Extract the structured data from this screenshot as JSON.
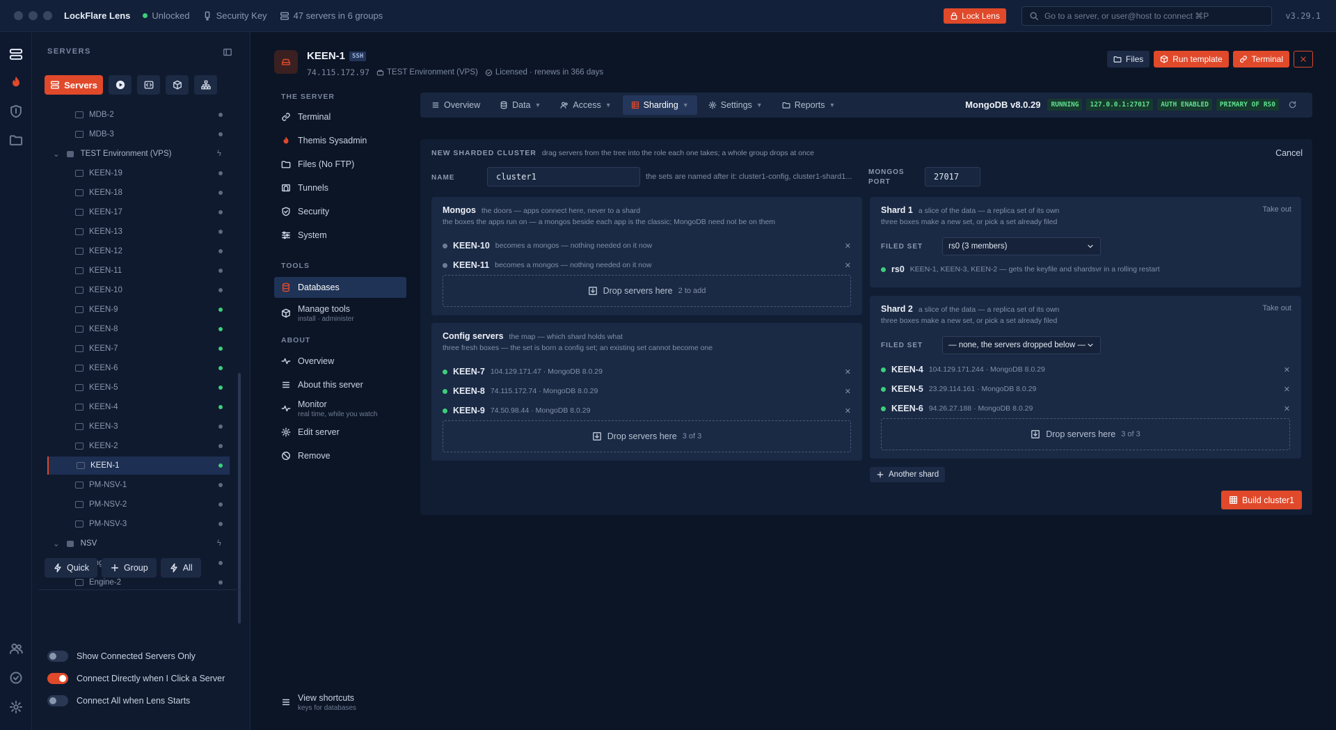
{
  "app": {
    "title": "LockFlare Lens",
    "status": "Unlocked",
    "security_key": "Security Key",
    "servers_summary": "47 servers in 6 groups",
    "lock_label": "Lock Lens",
    "search_placeholder": "Go to a server, or user@host to connect  ⌘P",
    "version": "v3.29.1",
    "accent": "#e0492a"
  },
  "sidebar": {
    "heading": "SERVERS",
    "primary_button": "Servers",
    "tree": [
      {
        "label": "MDB-2",
        "type": "server",
        "status": "grey"
      },
      {
        "label": "MDB-3",
        "type": "server",
        "status": "grey"
      },
      {
        "label": "TEST Environment (VPS)",
        "type": "group"
      },
      {
        "label": "KEEN-19",
        "type": "server",
        "status": "grey"
      },
      {
        "label": "KEEN-18",
        "type": "server",
        "status": "grey"
      },
      {
        "label": "KEEN-17",
        "type": "server",
        "status": "grey"
      },
      {
        "label": "KEEN-13",
        "type": "server",
        "status": "grey"
      },
      {
        "label": "KEEN-12",
        "type": "server",
        "status": "grey"
      },
      {
        "label": "KEEN-11",
        "type": "server",
        "status": "grey"
      },
      {
        "label": "KEEN-10",
        "type": "server",
        "status": "grey"
      },
      {
        "label": "KEEN-9",
        "type": "server",
        "status": "green"
      },
      {
        "label": "KEEN-8",
        "type": "server",
        "status": "green"
      },
      {
        "label": "KEEN-7",
        "type": "server",
        "status": "green"
      },
      {
        "label": "KEEN-6",
        "type": "server",
        "status": "green"
      },
      {
        "label": "KEEN-5",
        "type": "server",
        "status": "green"
      },
      {
        "label": "KEEN-4",
        "type": "server",
        "status": "green"
      },
      {
        "label": "KEEN-3",
        "type": "server",
        "status": "grey"
      },
      {
        "label": "KEEN-2",
        "type": "server",
        "status": "grey"
      },
      {
        "label": "KEEN-1",
        "type": "server",
        "status": "green",
        "selected": true
      },
      {
        "label": "PM-NSV-1",
        "type": "server",
        "status": "grey"
      },
      {
        "label": "PM-NSV-2",
        "type": "server",
        "status": "grey"
      },
      {
        "label": "PM-NSV-3",
        "type": "server",
        "status": "grey"
      },
      {
        "label": "NSV",
        "type": "group"
      },
      {
        "label": "Engine-1",
        "type": "server",
        "status": "grey"
      },
      {
        "label": "Engine-2",
        "type": "server",
        "status": "grey"
      }
    ],
    "actions": {
      "quick": "Quick",
      "group": "Group",
      "all": "All"
    },
    "toggles": [
      {
        "label": "Show Connected Servers Only",
        "on": false
      },
      {
        "label": "Connect Directly when I Click a Server",
        "on": true
      },
      {
        "label": "Connect All when Lens Starts",
        "on": false
      }
    ]
  },
  "server": {
    "name": "KEEN-1",
    "protocol": "SSH",
    "ip": "74.115.172.97",
    "group": "TEST Environment (VPS)",
    "license": "Licensed · renews in 366 days",
    "buttons": {
      "files": "Files",
      "run_template": "Run template",
      "terminal": "Terminal"
    }
  },
  "nav": {
    "the_server_heading": "THE SERVER",
    "the_server": [
      "Terminal",
      "Themis Sysadmin",
      "Files (No FTP)",
      "Tunnels",
      "Security",
      "System"
    ],
    "tools_heading": "TOOLS",
    "databases": "Databases",
    "manage_tools": "Manage tools",
    "manage_tools_sub": "install · administer",
    "about_heading": "ABOUT",
    "overview": "Overview",
    "about_server": "About this server",
    "monitor": "Monitor",
    "monitor_sub": "real time, while you watch",
    "edit": "Edit server",
    "remove": "Remove",
    "shortcuts": "View shortcuts",
    "shortcuts_sub": "keys for databases"
  },
  "tabs": [
    "Overview",
    "Data",
    "Access",
    "Sharding",
    "Settings",
    "Reports"
  ],
  "mongodb": {
    "version": "MongoDB v8.0.29",
    "badges": [
      "RUNNING",
      "127.0.0.1:27017",
      "AUTH ENABLED",
      "PRIMARY OF RS0"
    ]
  },
  "cluster": {
    "heading": "NEW SHARDED CLUSTER",
    "heading_hint": "drag servers from the tree into the role each one takes; a whole group drops at once",
    "cancel": "Cancel",
    "name_label": "NAME",
    "name_value": "cluster1",
    "name_hint": "the sets are named after it: cluster1-config, cluster1-shard1...",
    "port_label_1": "MONGOS",
    "port_label_2": "PORT",
    "port_value": "27017",
    "drop_label": "Drop servers here",
    "mongos": {
      "title": "Mongos",
      "tagline": "the doors — apps connect here, never to a shard",
      "sub": "the boxes the apps run on — a mongos beside each app is the classic; MongoDB need not be on them",
      "members": [
        {
          "name": "KEEN-10",
          "info": "becomes a mongos — nothing needed on it now"
        },
        {
          "name": "KEEN-11",
          "info": "becomes a mongos — nothing needed on it now"
        }
      ],
      "count": "2 to add"
    },
    "config": {
      "title": "Config servers",
      "tagline": "the map — which shard holds what",
      "sub": "three fresh boxes — the set is born a config set; an existing set cannot become one",
      "members": [
        {
          "name": "KEEN-7",
          "info": "104.129.171.47 · MongoDB 8.0.29"
        },
        {
          "name": "KEEN-8",
          "info": "74.115.172.74 · MongoDB 8.0.29"
        },
        {
          "name": "KEEN-9",
          "info": "74.50.98.44 · MongoDB 8.0.29"
        }
      ],
      "count": "3 of 3"
    },
    "shard1": {
      "title": "Shard 1",
      "tagline": "a slice of the data — a replica set of its own",
      "sub": "three boxes make a new set, or pick a set already filed",
      "take_out": "Take out",
      "filed_label": "FILED SET",
      "filed_value": "rs0 (3 members)",
      "rs_name": "rs0",
      "rs_info": "KEEN-1, KEEN-3, KEEN-2 — gets the keyfile and shardsvr in a rolling restart"
    },
    "shard2": {
      "title": "Shard 2",
      "tagline": "a slice of the data — a replica set of its own",
      "sub": "three boxes make a new set, or pick a set already filed",
      "take_out": "Take out",
      "filed_label": "FILED SET",
      "filed_value": "— none, the servers dropped below —",
      "members": [
        {
          "name": "KEEN-4",
          "info": "104.129.171.244 · MongoDB 8.0.29"
        },
        {
          "name": "KEEN-5",
          "info": "23.29.114.161 · MongoDB 8.0.29"
        },
        {
          "name": "KEEN-6",
          "info": "94.26.27.188 · MongoDB 8.0.29"
        }
      ],
      "count": "3 of 3"
    },
    "another_shard": "Another shard",
    "build": "Build cluster1"
  }
}
